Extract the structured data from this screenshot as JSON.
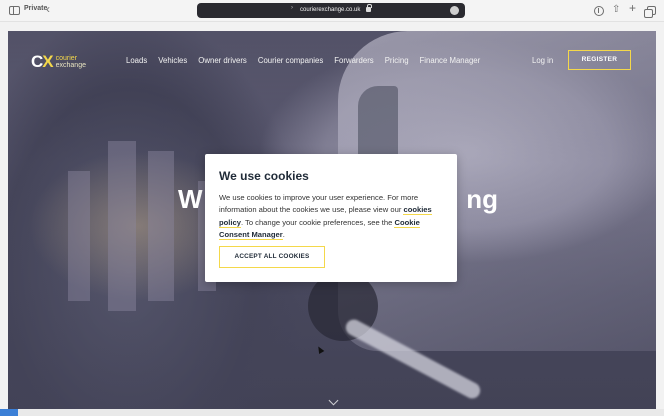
{
  "browser": {
    "private_label": "Private",
    "back_glyph": "‹",
    "address_arrow": "›",
    "url": "courierexchange.co.uk",
    "share_glyph": "⇧",
    "plus_glyph": "+"
  },
  "site": {
    "logo": {
      "mark_c": "C",
      "mark_x": "X",
      "line1": "courier",
      "line2": "exchange"
    },
    "nav": [
      {
        "label": "Loads"
      },
      {
        "label": "Vehicles"
      },
      {
        "label": "Owner drivers"
      },
      {
        "label": "Courier companies"
      },
      {
        "label": "Forwarders"
      },
      {
        "label": "Pricing"
      },
      {
        "label": "Finance Manager"
      }
    ],
    "login_label": "Log in",
    "register_label": "REGISTER",
    "hero": {
      "left_fragment": "W",
      "right_fragment": "ng"
    }
  },
  "cookie": {
    "title": "We use cookies",
    "text_1": "We use cookies to improve your user experience. For more information about the cookies we use, please view our ",
    "policy_link": "cookies policy",
    "text_2": ". To change your cookie preferences, see the ",
    "manager_link": "Cookie Consent Manager",
    "text_3": ".",
    "accept_label": "ACCEPT ALL COOKIES"
  },
  "colors": {
    "accent": "#f4d84a",
    "dark_text": "#1f2a37"
  }
}
